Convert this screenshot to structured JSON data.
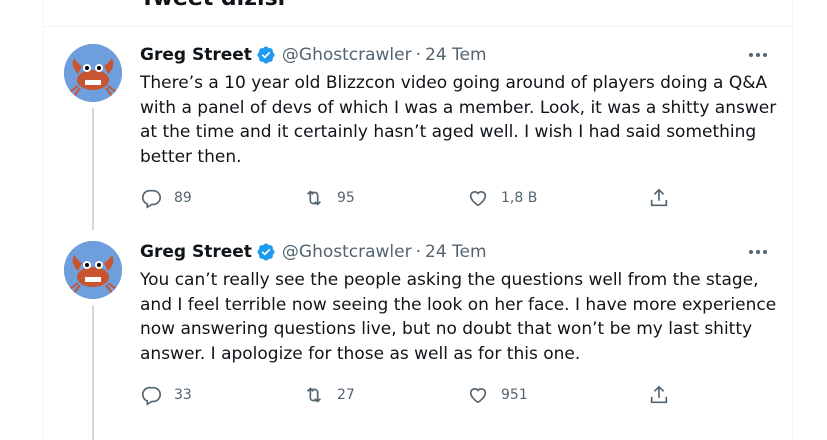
{
  "top": {
    "title": "Tweet dizisi"
  },
  "tweets": [
    {
      "name": "Greg Street",
      "handle": "@Ghostcrawler",
      "separator": "·",
      "time": "24 Tem",
      "text": "There’s a 10 year old Blizzcon video going around of players doing a Q&A with a panel of devs of which I was a member. Look, it was a shitty answer at the time and it certainly hasn’t aged well. I wish I had said something better then.",
      "reply_count": "89",
      "retweet_count": "95",
      "like_count": "1,8 B"
    },
    {
      "name": "Greg Street",
      "handle": "@Ghostcrawler",
      "separator": "·",
      "time": "24 Tem",
      "text": "You can’t really see the people asking the questions well from the stage, and I feel terrible now seeing the look on her face. I have more experience now answering questions live, but no doubt that won’t be my last shitty answer. I apologize for those as well as for this one.",
      "reply_count": "33",
      "retweet_count": "27",
      "like_count": "951"
    }
  ],
  "colors": {
    "verified": "#1d9bf0",
    "muted": "#536471",
    "avatar_bg": "#6e9fdc",
    "crab": "#c8552f"
  }
}
